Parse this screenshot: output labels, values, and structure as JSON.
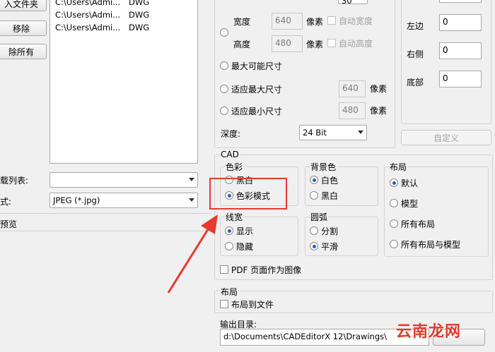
{
  "left": {
    "buttons": {
      "add_folder": "入文件夹",
      "remove": "移除",
      "remove_all": "除所有"
    },
    "files": [
      {
        "path": "C:\\Users\\Admi...",
        "type": "DWG"
      },
      {
        "path": "C:\\Users\\Admi...",
        "type": "DWG"
      },
      {
        "path": "C:\\Users\\Admi...",
        "type": "DWG"
      }
    ],
    "load_list_label": "载列表:",
    "load_list_value": "",
    "format_label": "式:",
    "format_value": "JPEG (*.jpg)",
    "preview_label": "预览"
  },
  "size": {
    "top_combo_partial": "30",
    "width_label": "宽度",
    "width_value": "640",
    "width_unit": "像素",
    "auto_width": "自动宽度",
    "height_label": "高度",
    "height_value": "480",
    "height_unit": "像素",
    "auto_height": "自动高度",
    "max_possible": "最大可能尺寸",
    "fit_max": "适应最大尺寸",
    "fit_max_value": "640",
    "fit_max_unit": "像素",
    "fit_min": "适应最小尺寸",
    "fit_min_value": "480",
    "fit_min_unit": "像素",
    "depth_label": "深度:",
    "depth_value": "24 Bit"
  },
  "margins": {
    "left_label": "左边",
    "left_value": "0",
    "right_label": "右侧",
    "right_value": "0",
    "bottom_label": "底部",
    "bottom_value": "0",
    "custom_button": "自定义"
  },
  "cad": {
    "title": "CAD",
    "color_group": {
      "title": "色彩",
      "options": [
        "黑白",
        "色彩模式"
      ],
      "selected": 1
    },
    "background_group": {
      "title": "背景色",
      "options": [
        "白色",
        "黑白"
      ],
      "selected": 0
    },
    "layout_group": {
      "title": "布局",
      "options": [
        "默认",
        "模型",
        "所有布局",
        "所有布局与模型"
      ],
      "selected": 0
    },
    "lineweight_group": {
      "title": "线宽",
      "options": [
        "显示",
        "隐藏"
      ],
      "selected": 0
    },
    "arc_group": {
      "title": "圆弧",
      "options": [
        "分割",
        "平滑"
      ],
      "selected": 1
    },
    "pdf_as_image": "PDF 页面作为图像"
  },
  "layout": {
    "title": "布局",
    "layout_to_file": "布局到文件"
  },
  "output": {
    "label": "输出目录:",
    "path": "d:\\Documents\\CADEditorX 12\\Drawings\\"
  },
  "watermark": "云南龙网",
  "colors": {
    "highlight_red": "#e8392f",
    "radio_fill": "#2a5cc7"
  }
}
